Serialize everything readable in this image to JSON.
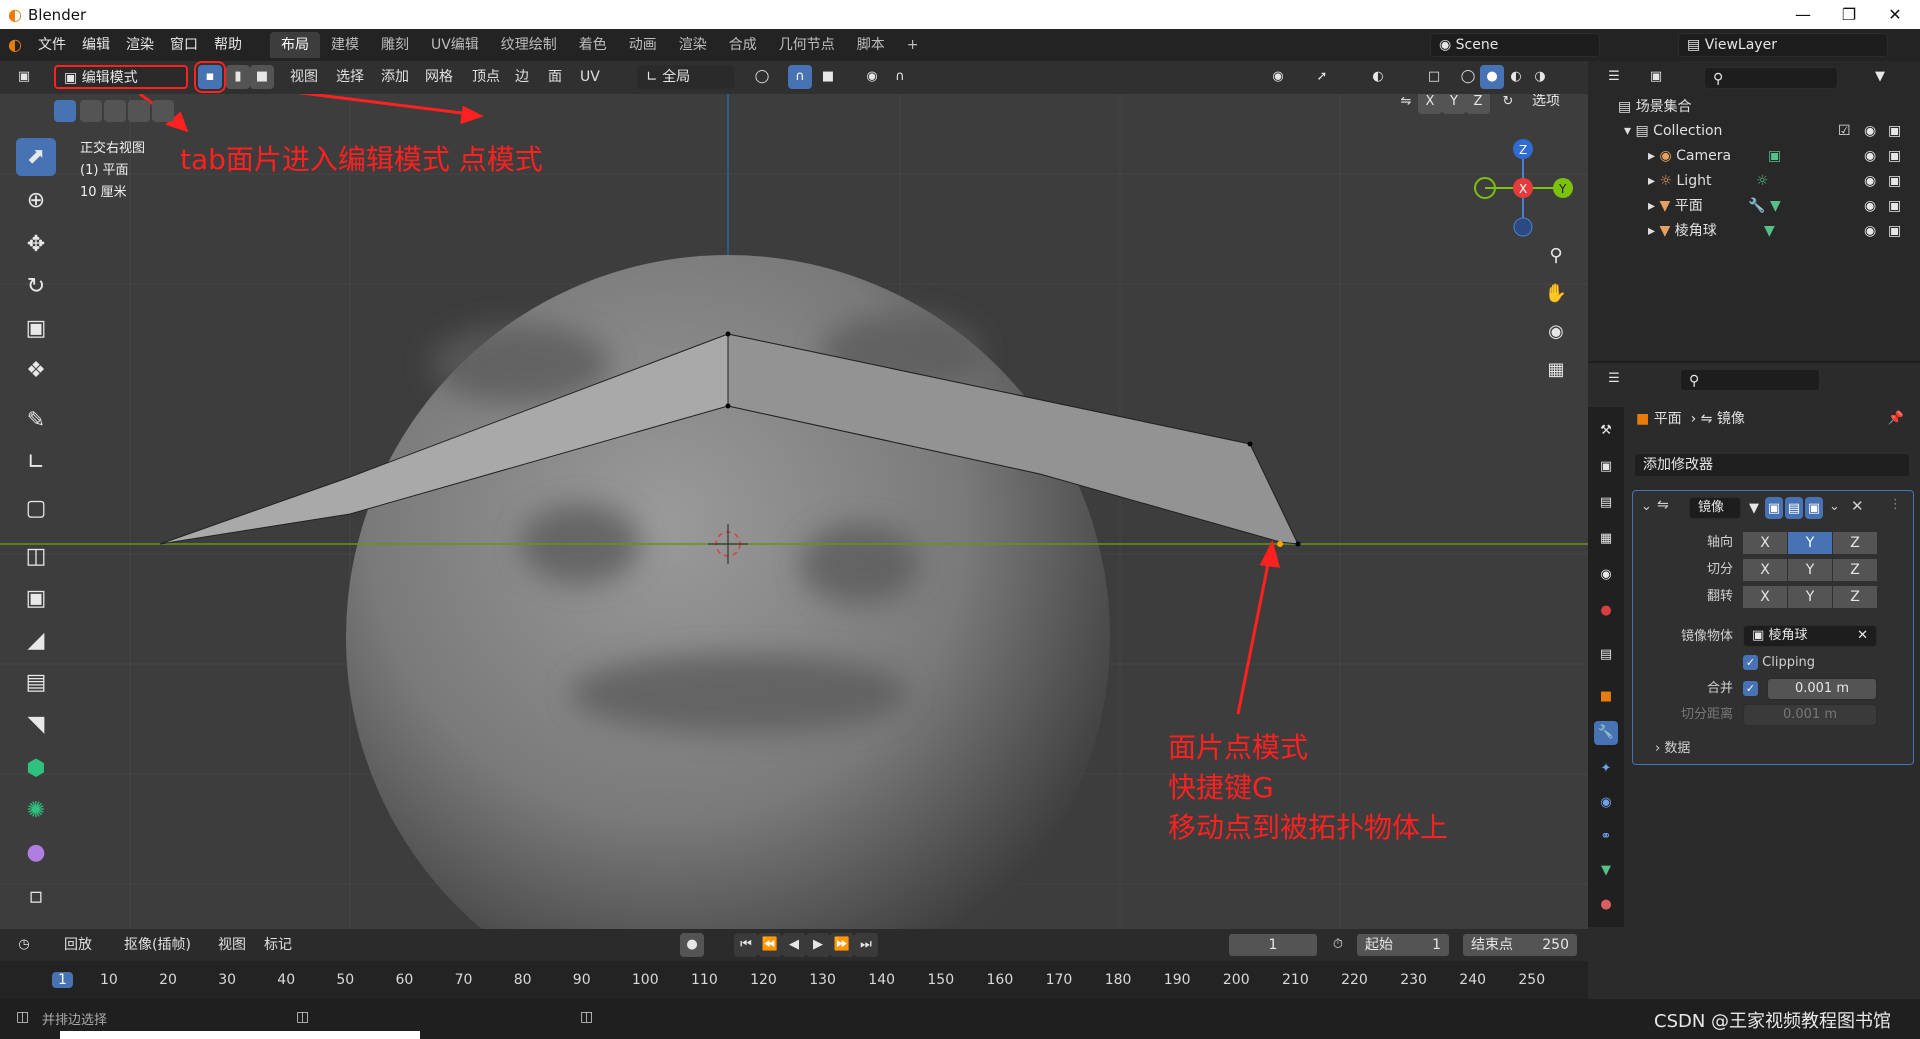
{
  "window": {
    "title": "Blender"
  },
  "menus": [
    "文件",
    "编辑",
    "渲染",
    "窗口",
    "帮助"
  ],
  "workspaces": [
    {
      "label": "布局",
      "active": true
    },
    {
      "label": "建模"
    },
    {
      "label": "雕刻"
    },
    {
      "label": "UV编辑"
    },
    {
      "label": "纹理绘制"
    },
    {
      "label": "着色"
    },
    {
      "label": "动画"
    },
    {
      "label": "渲染"
    },
    {
      "label": "合成"
    },
    {
      "label": "几何节点"
    },
    {
      "label": "脚本"
    },
    {
      "label": "+"
    }
  ],
  "scene": "Scene",
  "view_layer": "ViewLayer",
  "viewport_header": {
    "mode": "编辑模式",
    "menus": [
      "视图",
      "选择",
      "添加",
      "网格",
      "顶点",
      "边",
      "面",
      "UV"
    ],
    "orientation": "全局",
    "axes": [
      "X",
      "Y",
      "Z"
    ],
    "options": "选项"
  },
  "viewport_info": [
    "正交右视图",
    "(1) 平面",
    "10 厘米"
  ],
  "gizmo": {
    "z": "Z",
    "x": "X",
    "y": "Y"
  },
  "annotations": {
    "top": "tab面片进入编辑模式 点模式",
    "right": [
      "面片点模式",
      "快捷键G",
      "移动点到被拓扑物体上"
    ]
  },
  "outliner": {
    "root": "场景集合",
    "collection": "Collection",
    "items": [
      "Camera",
      "Light",
      "平面",
      "棱角球"
    ]
  },
  "properties": {
    "breadcrumb": [
      "平面",
      "镜像"
    ],
    "add_modifier": "添加修改器",
    "modifier_name": "镜像",
    "rows": {
      "axis_label": "轴向",
      "bisect_label": "切分",
      "flip_label": "翻转",
      "mirror_object_label": "镜像物体",
      "mirror_object": "棱角球",
      "clipping": "Clipping",
      "merge_label": "合并",
      "merge_value": "0.001 m",
      "bisect_distance_label": "切分距离",
      "bisect_distance_value": "0.001 m",
      "data_label": "数据"
    },
    "xyz": [
      "X",
      "Y",
      "Z"
    ]
  },
  "timeline": {
    "menus": [
      "回放",
      "抠像(插帧)",
      "视图",
      "标记"
    ],
    "current_frame": "1",
    "start_label": "起始",
    "start": "1",
    "end_label": "结束点",
    "end": "250",
    "ticks": [
      "1",
      "10",
      "20",
      "30",
      "40",
      "50",
      "60",
      "70",
      "80",
      "90",
      "100",
      "110",
      "120",
      "130",
      "140",
      "150",
      "160",
      "170",
      "180",
      "190",
      "200",
      "210",
      "220",
      "230",
      "240",
      "250"
    ]
  },
  "status": {
    "left": "并排边选择",
    "watermark": "CSDN @王家视频教程图书馆"
  },
  "colors": {
    "accent": "#4772b3",
    "annotation": "#ff2020",
    "orange": "#e87d0d"
  }
}
